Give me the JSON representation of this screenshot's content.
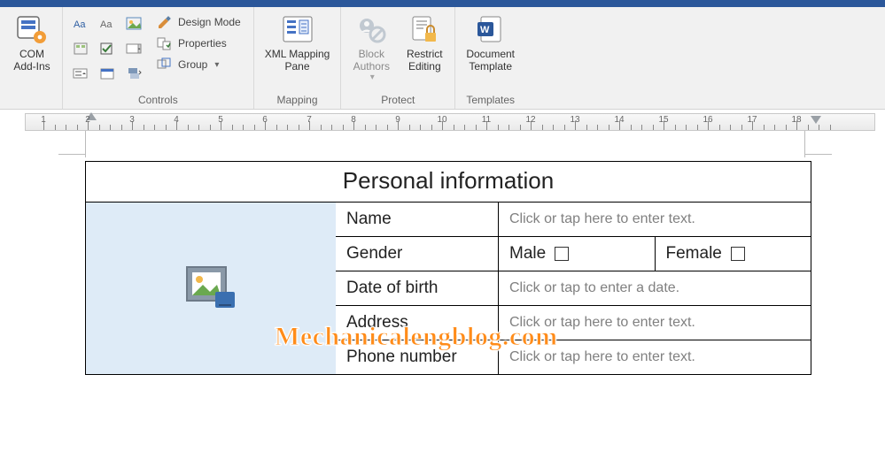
{
  "ribbon": {
    "addins": {
      "com_addins": "COM\nAdd-Ins",
      "group_label": ""
    },
    "controls": {
      "design_mode": "Design Mode",
      "properties": "Properties",
      "group": "Group",
      "group_label": "Controls"
    },
    "mapping": {
      "xml_pane": "XML Mapping\nPane",
      "group_label": "Mapping"
    },
    "protect": {
      "block_authors": "Block\nAuthors",
      "restrict_editing": "Restrict\nEditing",
      "group_label": "Protect"
    },
    "templates": {
      "doc_template": "Document\nTemplate",
      "group_label": "Templates"
    }
  },
  "ruler_numbers": [
    "1",
    "2",
    "3",
    "4",
    "5",
    "6",
    "7",
    "8",
    "9",
    "10",
    "11",
    "12",
    "13",
    "14",
    "15",
    "16",
    "17",
    "18"
  ],
  "form": {
    "title": "Personal information",
    "name_label": "Name",
    "name_ph": "Click or tap here to enter text.",
    "gender_label": "Gender",
    "male": "Male",
    "female": "Female",
    "dob_label": "Date of birth",
    "dob_ph": "Click or tap to enter a date.",
    "address_label": "Address",
    "address_ph": "Click or tap here to enter text.",
    "phone_label": "Phone number",
    "phone_ph": "Click or tap here to enter text."
  },
  "watermark": "Mechanicalengblog.com"
}
